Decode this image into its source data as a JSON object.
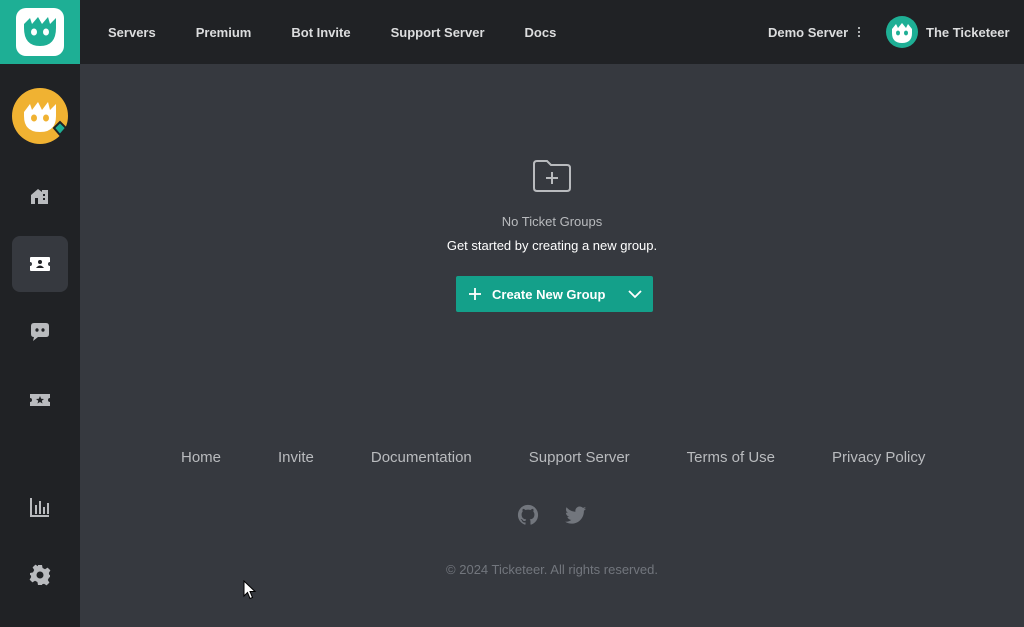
{
  "nav": {
    "items": [
      {
        "label": "Servers"
      },
      {
        "label": "Premium"
      },
      {
        "label": "Bot Invite"
      },
      {
        "label": "Support Server"
      },
      {
        "label": "Docs"
      }
    ],
    "server_selector": "Demo Server",
    "user_name": "The Ticketeer"
  },
  "sidebar": {
    "items": [
      {
        "icon": "home-icon",
        "active": false
      },
      {
        "icon": "ticket-groups-icon",
        "active": true
      },
      {
        "icon": "chat-icon",
        "active": false
      },
      {
        "icon": "premium-ticket-icon",
        "active": false
      },
      {
        "icon": "stats-chart-icon",
        "active": false
      },
      {
        "icon": "gear-icon",
        "active": false
      }
    ]
  },
  "empty_state": {
    "title": "No Ticket Groups",
    "subtitle": "Get started by creating a new group.",
    "button_label": "Create New Group"
  },
  "footer": {
    "links": [
      "Home",
      "Invite",
      "Documentation",
      "Support Server",
      "Terms of Use",
      "Privacy Policy"
    ],
    "copyright": "© 2024 Ticketeer. All rights reserved."
  },
  "colors": {
    "accent": "#14a08a",
    "logo_bg": "#1eaf95",
    "sidebar_bg": "#202225",
    "content_bg": "#36393f",
    "guild_avatar": "#f0b232"
  }
}
